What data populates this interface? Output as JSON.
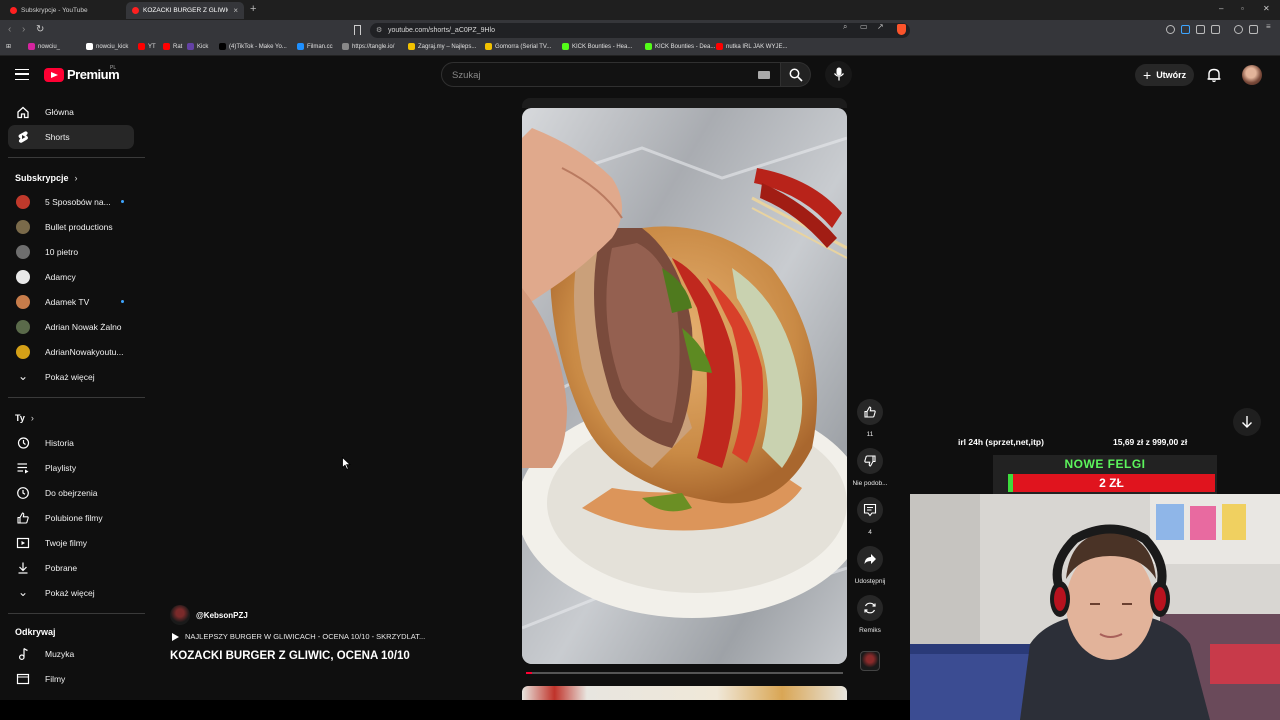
{
  "browser": {
    "tabs": [
      {
        "label": "Subskrypcje - YouTube",
        "active": false
      },
      {
        "label": "KOZACKI BURGER Z GLIWIC, ...",
        "active": true
      }
    ],
    "new_tab_symbol": "+",
    "url": "youtube.com/shorts/_aC0PZ_9Hlo",
    "bookmarks": [
      {
        "label": "nowciu_",
        "color": "#d6249f"
      },
      {
        "label": "nowciu_kick",
        "color": "#ffffff"
      },
      {
        "label": "YT",
        "color": "#ff0000"
      },
      {
        "label": "Rat",
        "color": "#ff0000"
      },
      {
        "label": "Kick",
        "color": "#6441a5"
      },
      {
        "label": "(4)TikTok - Make Yo...",
        "color": "#000000"
      },
      {
        "label": "Filman.cc",
        "color": "#1e90ff"
      },
      {
        "label": "https://tangle.io/",
        "color": "#888888"
      },
      {
        "label": "Zagraj.my – Najleps...",
        "color": "#f2c200"
      },
      {
        "label": "Gomorra (Serial TV...",
        "color": "#f2c200"
      },
      {
        "label": "KICK Bounties - Hea...",
        "color": "#53fc18"
      },
      {
        "label": "KICK Bounties - Dea...",
        "color": "#53fc18"
      },
      {
        "label": "nutka IRL JAK WYJE...",
        "color": "#ff0000"
      }
    ]
  },
  "masthead": {
    "logo_text": "Premium",
    "logo_country": "PL",
    "search_placeholder": "Szukaj",
    "create_label": "Utwórz"
  },
  "sidebar": {
    "main": [
      {
        "label": "Główna",
        "icon": "home-icon",
        "selected": false
      },
      {
        "label": "Shorts",
        "icon": "shorts-icon",
        "selected": true
      }
    ],
    "subscriptions_header": "Subskrypcje",
    "subscriptions": [
      {
        "label": "5 Sposobów na...",
        "new": true,
        "color": "#c0392b"
      },
      {
        "label": "Bullet productions",
        "new": false,
        "color": "#7a6a4a"
      },
      {
        "label": "10 pietro",
        "new": false,
        "color": "#6e6e6e"
      },
      {
        "label": "Adamcy",
        "new": false,
        "color": "#e8e8e8"
      },
      {
        "label": "Adamek TV",
        "new": true,
        "color": "#c77c4a"
      },
      {
        "label": "Adrian Nowak Żalno",
        "new": false,
        "color": "#5a6a4a"
      },
      {
        "label": "AdrianNowakyoutu...",
        "new": false,
        "color": "#d4a017"
      }
    ],
    "show_more_1": "Pokaż więcej",
    "you_header": "Ty",
    "you_items": [
      {
        "label": "Historia",
        "icon": "history-icon"
      },
      {
        "label": "Playlisty",
        "icon": "playlists-icon"
      },
      {
        "label": "Do obejrzenia",
        "icon": "watch-later-icon"
      },
      {
        "label": "Polubione filmy",
        "icon": "liked-videos-icon"
      },
      {
        "label": "Twoje filmy",
        "icon": "your-videos-icon"
      },
      {
        "label": "Pobrane",
        "icon": "downloads-icon"
      }
    ],
    "show_more_2": "Pokaż więcej",
    "explore_header": "Odkrywaj",
    "explore_items": [
      {
        "label": "Muzyka",
        "icon": "music-icon"
      },
      {
        "label": "Filmy",
        "icon": "movies-icon"
      }
    ]
  },
  "short": {
    "channel": "@KebsonPZJ",
    "music": "NAJLEPSZY BURGER W GLIWICACH - OCENA 10/10 - SKRZYDLAT...",
    "title": "KOZACKI BURGER Z GLIWIC, OCENA 10/10",
    "progress": 0.02,
    "actions": {
      "like_count": "11",
      "dislike_label": "Nie podob...",
      "comments_count": "4",
      "share_label": "Udostępnij",
      "remix_label": "Remiks"
    }
  },
  "stream_overlay": {
    "goal_label": "irl 24h (sprzet,net,itp)",
    "goal_amount": "15,69 zł  z  999,00 zł",
    "goal_progress": 0.016,
    "felgi_title": "NOWE FELGI",
    "felgi_price": "2 ZŁ"
  },
  "colors": {
    "accent_red": "#ff0033",
    "background": "#0f0f0f",
    "new_dot": "#3ea6ff",
    "overlay_green": "#5cf55c"
  }
}
